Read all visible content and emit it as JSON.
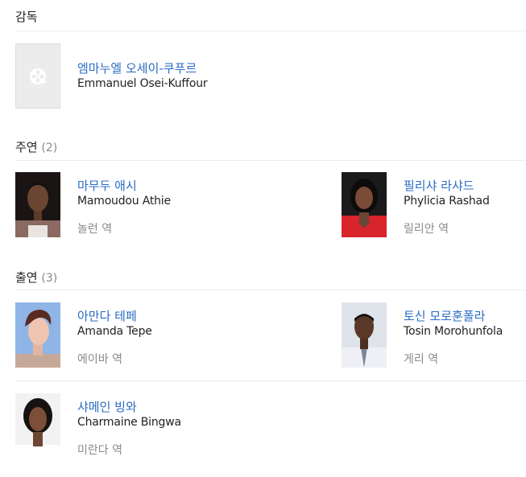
{
  "director": {
    "title": "감독",
    "person": {
      "name_ko": "엠마누엘 오세이-쿠푸르",
      "name_en": "Emmanuel Osei-Kuffour",
      "photo": "film-reel-icon"
    }
  },
  "lead": {
    "title": "주연",
    "count": "(2)",
    "people": [
      {
        "name_ko": "마무두 애시",
        "name_en": "Mamoudou Athie",
        "role": "놀런 역"
      },
      {
        "name_ko": "필리샤 라샤드",
        "name_en": "Phylicia Rashad",
        "role": "릴리안 역"
      }
    ]
  },
  "supporting": {
    "title": "출연",
    "count": "(3)",
    "people": [
      {
        "name_ko": "아만다 테페",
        "name_en": "Amanda Tepe",
        "role": "에이바 역"
      },
      {
        "name_ko": "토신 모로훈폴라",
        "name_en": "Tosin Morohunfola",
        "role": "게리 역"
      },
      {
        "name_ko": "샤메인 빙와",
        "name_en": "Charmaine Bingwa",
        "role": "미란다 역"
      }
    ]
  },
  "colors": {
    "link": "#2b6cc4",
    "role_text": "#8a8a8a",
    "divider": "#ececec"
  }
}
